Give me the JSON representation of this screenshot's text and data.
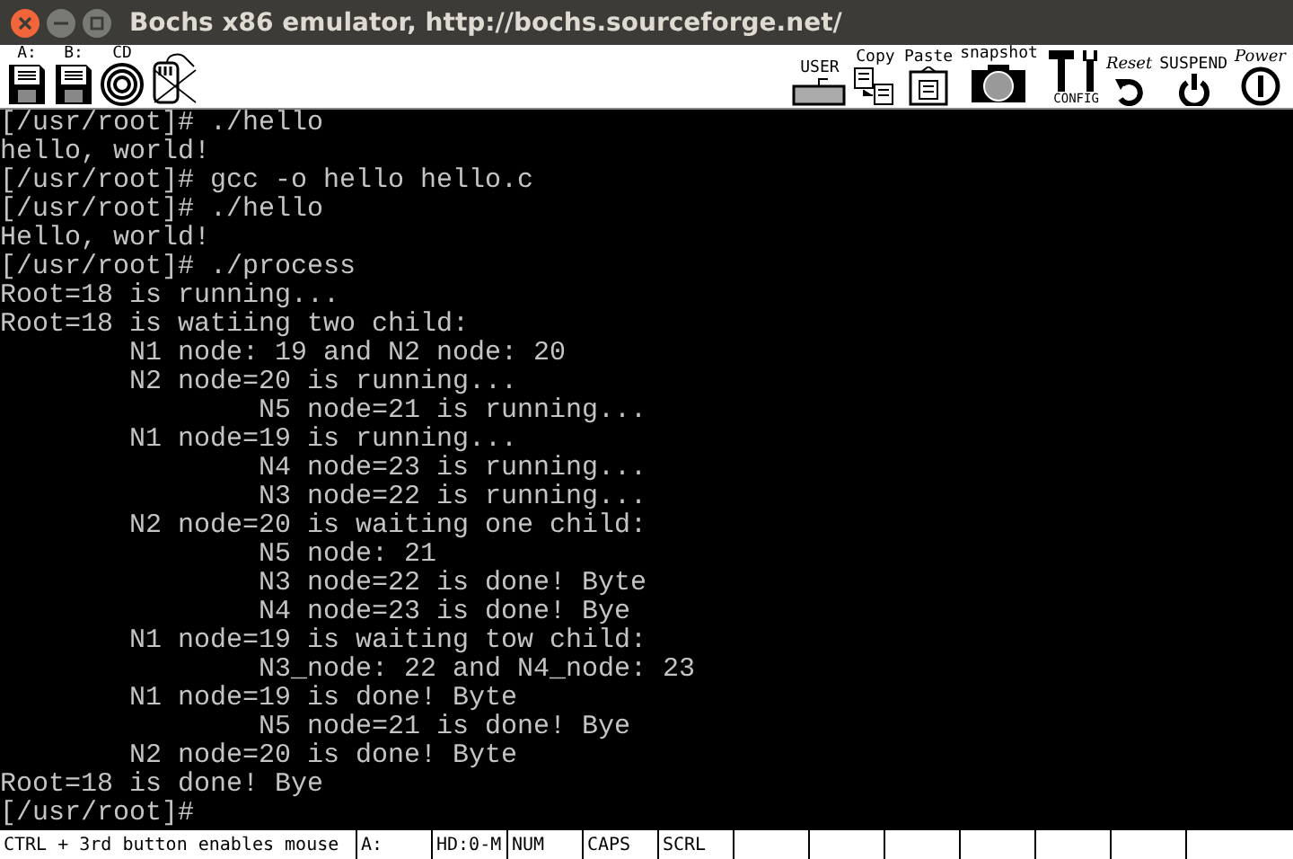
{
  "window": {
    "title": "Bochs x86 emulator, http://bochs.sourceforge.net/"
  },
  "toolbar_left": [
    {
      "label": "A:",
      "kind": "floppy"
    },
    {
      "label": "B:",
      "kind": "floppy"
    },
    {
      "label": "CD",
      "kind": "cdrom"
    },
    {
      "kind": "mouse"
    }
  ],
  "toolbar_right": [
    {
      "label": "USER",
      "kind": "keyboard"
    },
    {
      "label": "Copy",
      "kind": "copy"
    },
    {
      "label": "Paste",
      "kind": "paste"
    },
    {
      "label": "snapshot",
      "kind": "camera"
    },
    {
      "label": "CONFIG",
      "kind": "config"
    },
    {
      "label": "Reset",
      "kind": "reset"
    },
    {
      "label": "SUSPEND",
      "kind": "suspend"
    },
    {
      "label": "Power",
      "kind": "power"
    }
  ],
  "terminal_lines": [
    "[/usr/root]# ./hello",
    "hello, world!",
    "[/usr/root]# gcc -o hello hello.c",
    "[/usr/root]# ./hello",
    "Hello, world!",
    "[/usr/root]# ./process",
    "Root=18 is running...",
    "Root=18 is watiing two child:",
    "        N1 node: 19 and N2 node: 20",
    "        N2 node=20 is running...",
    "                N5 node=21 is running...",
    "        N1 node=19 is running...",
    "                N4 node=23 is running...",
    "                N3 node=22 is running...",
    "        N2 node=20 is waiting one child:",
    "                N5 node: 21",
    "                N3 node=22 is done! Byte",
    "                N4 node=23 is done! Bye",
    "        N1 node=19 is waiting tow child:",
    "                N3_node: 22 and N4_node: 23",
    "        N1 node=19 is done! Byte",
    "                N5 node=21 is done! Bye",
    "        N2 node=20 is done! Byte",
    "Root=18 is done! Bye",
    "[/usr/root]# "
  ],
  "status_bar": [
    "CTRL + 3rd button enables mouse",
    "A:",
    "HD:0-M",
    "NUM",
    "CAPS",
    "SCRL"
  ]
}
